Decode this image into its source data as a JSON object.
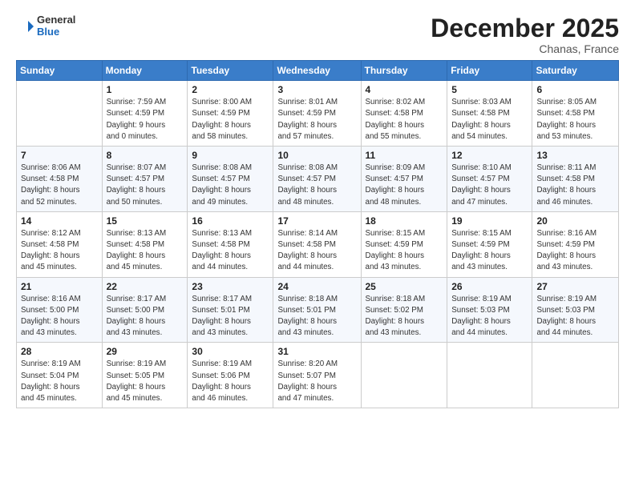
{
  "header": {
    "logo_line1": "General",
    "logo_line2": "Blue",
    "month_title": "December 2025",
    "location": "Chanas, France"
  },
  "weekdays": [
    "Sunday",
    "Monday",
    "Tuesday",
    "Wednesday",
    "Thursday",
    "Friday",
    "Saturday"
  ],
  "weeks": [
    [
      {
        "day": "",
        "info": ""
      },
      {
        "day": "1",
        "info": "Sunrise: 7:59 AM\nSunset: 4:59 PM\nDaylight: 9 hours\nand 0 minutes."
      },
      {
        "day": "2",
        "info": "Sunrise: 8:00 AM\nSunset: 4:59 PM\nDaylight: 8 hours\nand 58 minutes."
      },
      {
        "day": "3",
        "info": "Sunrise: 8:01 AM\nSunset: 4:59 PM\nDaylight: 8 hours\nand 57 minutes."
      },
      {
        "day": "4",
        "info": "Sunrise: 8:02 AM\nSunset: 4:58 PM\nDaylight: 8 hours\nand 55 minutes."
      },
      {
        "day": "5",
        "info": "Sunrise: 8:03 AM\nSunset: 4:58 PM\nDaylight: 8 hours\nand 54 minutes."
      },
      {
        "day": "6",
        "info": "Sunrise: 8:05 AM\nSunset: 4:58 PM\nDaylight: 8 hours\nand 53 minutes."
      }
    ],
    [
      {
        "day": "7",
        "info": "Sunrise: 8:06 AM\nSunset: 4:58 PM\nDaylight: 8 hours\nand 52 minutes."
      },
      {
        "day": "8",
        "info": "Sunrise: 8:07 AM\nSunset: 4:57 PM\nDaylight: 8 hours\nand 50 minutes."
      },
      {
        "day": "9",
        "info": "Sunrise: 8:08 AM\nSunset: 4:57 PM\nDaylight: 8 hours\nand 49 minutes."
      },
      {
        "day": "10",
        "info": "Sunrise: 8:08 AM\nSunset: 4:57 PM\nDaylight: 8 hours\nand 48 minutes."
      },
      {
        "day": "11",
        "info": "Sunrise: 8:09 AM\nSunset: 4:57 PM\nDaylight: 8 hours\nand 48 minutes."
      },
      {
        "day": "12",
        "info": "Sunrise: 8:10 AM\nSunset: 4:57 PM\nDaylight: 8 hours\nand 47 minutes."
      },
      {
        "day": "13",
        "info": "Sunrise: 8:11 AM\nSunset: 4:58 PM\nDaylight: 8 hours\nand 46 minutes."
      }
    ],
    [
      {
        "day": "14",
        "info": "Sunrise: 8:12 AM\nSunset: 4:58 PM\nDaylight: 8 hours\nand 45 minutes."
      },
      {
        "day": "15",
        "info": "Sunrise: 8:13 AM\nSunset: 4:58 PM\nDaylight: 8 hours\nand 45 minutes."
      },
      {
        "day": "16",
        "info": "Sunrise: 8:13 AM\nSunset: 4:58 PM\nDaylight: 8 hours\nand 44 minutes."
      },
      {
        "day": "17",
        "info": "Sunrise: 8:14 AM\nSunset: 4:58 PM\nDaylight: 8 hours\nand 44 minutes."
      },
      {
        "day": "18",
        "info": "Sunrise: 8:15 AM\nSunset: 4:59 PM\nDaylight: 8 hours\nand 43 minutes."
      },
      {
        "day": "19",
        "info": "Sunrise: 8:15 AM\nSunset: 4:59 PM\nDaylight: 8 hours\nand 43 minutes."
      },
      {
        "day": "20",
        "info": "Sunrise: 8:16 AM\nSunset: 4:59 PM\nDaylight: 8 hours\nand 43 minutes."
      }
    ],
    [
      {
        "day": "21",
        "info": "Sunrise: 8:16 AM\nSunset: 5:00 PM\nDaylight: 8 hours\nand 43 minutes."
      },
      {
        "day": "22",
        "info": "Sunrise: 8:17 AM\nSunset: 5:00 PM\nDaylight: 8 hours\nand 43 minutes."
      },
      {
        "day": "23",
        "info": "Sunrise: 8:17 AM\nSunset: 5:01 PM\nDaylight: 8 hours\nand 43 minutes."
      },
      {
        "day": "24",
        "info": "Sunrise: 8:18 AM\nSunset: 5:01 PM\nDaylight: 8 hours\nand 43 minutes."
      },
      {
        "day": "25",
        "info": "Sunrise: 8:18 AM\nSunset: 5:02 PM\nDaylight: 8 hours\nand 43 minutes."
      },
      {
        "day": "26",
        "info": "Sunrise: 8:19 AM\nSunset: 5:03 PM\nDaylight: 8 hours\nand 44 minutes."
      },
      {
        "day": "27",
        "info": "Sunrise: 8:19 AM\nSunset: 5:03 PM\nDaylight: 8 hours\nand 44 minutes."
      }
    ],
    [
      {
        "day": "28",
        "info": "Sunrise: 8:19 AM\nSunset: 5:04 PM\nDaylight: 8 hours\nand 45 minutes."
      },
      {
        "day": "29",
        "info": "Sunrise: 8:19 AM\nSunset: 5:05 PM\nDaylight: 8 hours\nand 45 minutes."
      },
      {
        "day": "30",
        "info": "Sunrise: 8:19 AM\nSunset: 5:06 PM\nDaylight: 8 hours\nand 46 minutes."
      },
      {
        "day": "31",
        "info": "Sunrise: 8:20 AM\nSunset: 5:07 PM\nDaylight: 8 hours\nand 47 minutes."
      },
      {
        "day": "",
        "info": ""
      },
      {
        "day": "",
        "info": ""
      },
      {
        "day": "",
        "info": ""
      }
    ]
  ]
}
